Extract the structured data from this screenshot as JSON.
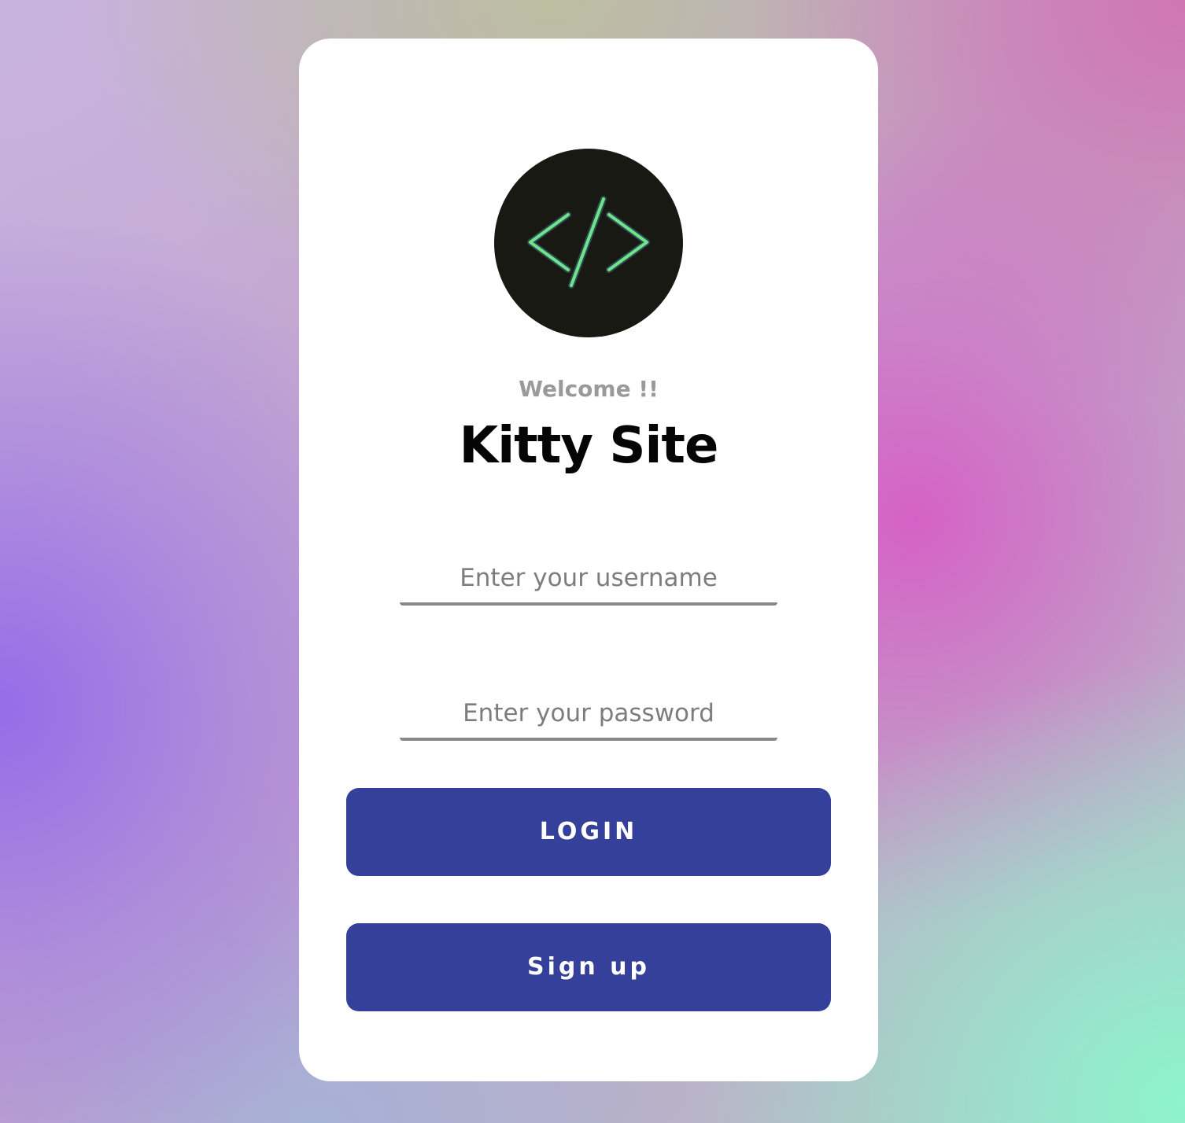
{
  "logo": {
    "icon": "code-brackets-icon",
    "background_color": "#181913",
    "stroke_color": "#6ee38a"
  },
  "welcome_text": "Welcome !!",
  "site_title": "Kitty Site",
  "username": {
    "placeholder": "Enter your username",
    "value": ""
  },
  "password": {
    "placeholder": "Enter your password",
    "value": ""
  },
  "buttons": {
    "login_label": "LOGIN",
    "signup_label": "Sign up"
  },
  "colors": {
    "button": "#35409a",
    "card": "#ffffff"
  }
}
